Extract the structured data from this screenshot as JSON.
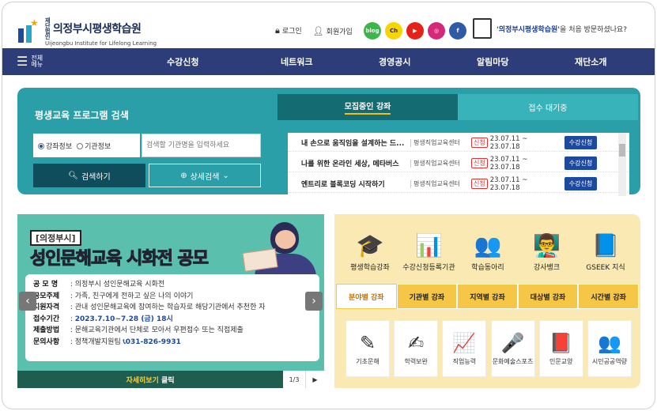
{
  "header": {
    "logo_small": "재단법인",
    "logo_title": "의정부시평생학습원",
    "logo_subtitle": "Uijeongbu Institute for Lifelong Learning",
    "login": "로그인",
    "signup": "회원가입",
    "sns": [
      {
        "name": "blog-icon",
        "label": "blog",
        "color": "#3cb54a"
      },
      {
        "name": "kakao-channel-icon",
        "label": "Ch",
        "color": "#f7d600"
      },
      {
        "name": "youtube-icon",
        "label": "▶",
        "color": "#e62117"
      },
      {
        "name": "instagram-icon",
        "label": "◎",
        "color": "#d6287a"
      },
      {
        "name": "facebook-icon",
        "label": "f",
        "color": "#2f5aa6"
      }
    ],
    "welcome_name": "'의정부시평생학습원'",
    "welcome_rest": "을 처음 방문하셨나요?"
  },
  "nav": {
    "menu_label": "전체 메뉴",
    "items": [
      "수강신청",
      "네트워크",
      "경영공시",
      "알림마당",
      "재단소개"
    ]
  },
  "search": {
    "title": "평생교육 프로그램 검색",
    "radio1": "강좌정보",
    "radio2": "기관정보",
    "placeholder": "검색할 기관명을 입력하세요",
    "search_btn": "검색하기",
    "detail_btn": "상세검색"
  },
  "courses": {
    "tab_active": "모집중인 강좌",
    "tab_inactive": "접수 대기중",
    "rows": [
      {
        "title": "내 손으로 움직임을 설계하는 드...",
        "org": "평생직업교육센터",
        "badge": "신청",
        "date": "23.07.11 ~ 23.07.18",
        "btn": "수강신청"
      },
      {
        "title": "나를 위한 온라인 세상, 메타버스",
        "org": "평생직업교육센터",
        "badge": "신청",
        "date": "23.07.11 ~ 23.07.18",
        "btn": "수강신청"
      },
      {
        "title": "엔트리로 블록코딩 시작하기",
        "org": "평생직업교육센터",
        "badge": "신청",
        "date": "23.07.11 ~ 23.07.18",
        "btn": "수강신청"
      }
    ]
  },
  "banner": {
    "tag": "[의정부시]",
    "headline_a": "성인문해교육",
    "headline_b": " 시화전 공모",
    "lines": [
      {
        "k": "공 모 명",
        "v": "의정부시 성인문해교육 시화전"
      },
      {
        "k": "공모주제",
        "v": "가족, 친구에게 전하고 싶은 나의 이야기"
      },
      {
        "k": "지원자격",
        "v": "관내 성인문해교육에 참여하는 학습자로 해당기관에서 추천한 자"
      },
      {
        "k": "접수기간",
        "v": "2023.7.10~7.28 (금) 18시"
      },
      {
        "k": "제출방법",
        "v": "문해교육기관에서 단체로 모아서 우편접수 또는 직접제출"
      },
      {
        "k": "문의사항",
        "v": "정책개발지원팀",
        "v2": "031-826-9931"
      }
    ],
    "more": "자세히보기",
    "more_click": " 클릭",
    "page": "1/3"
  },
  "services": [
    {
      "name": "lifelong-course-icon",
      "label": "평생학습강좌",
      "glyph": "🎓"
    },
    {
      "name": "registered-institution-icon",
      "label": "수강신청등록기관",
      "glyph": "📊"
    },
    {
      "name": "study-club-icon",
      "label": "학습동아리",
      "glyph": "👥"
    },
    {
      "name": "instructor-bank-icon",
      "label": "강사뱅크",
      "glyph": "👨‍🏫"
    },
    {
      "name": "gseek-icon",
      "label": "GSEEK 지식",
      "glyph": "📘"
    }
  ],
  "category_tabs": [
    "분야별 강좌",
    "기관별 강좌",
    "지역별 강좌",
    "대상별 강좌",
    "시간별 강좌"
  ],
  "categories": [
    {
      "name": "basic-literacy-icon",
      "label": "기초문해",
      "glyph": "✎"
    },
    {
      "name": "degree-icon",
      "label": "학력보완",
      "glyph": "✍"
    },
    {
      "name": "vocational-icon",
      "label": "직업능력",
      "glyph": "📈"
    },
    {
      "name": "culture-arts-icon",
      "label": "문화예술스포츠",
      "glyph": "🎤"
    },
    {
      "name": "humanities-icon",
      "label": "인문교양",
      "glyph": "📕"
    },
    {
      "name": "civic-icon",
      "label": "시민공공역량",
      "glyph": "👥"
    }
  ]
}
